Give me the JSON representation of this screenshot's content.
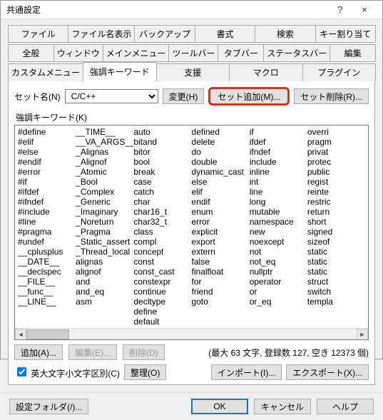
{
  "window": {
    "title": "共通設定",
    "help": "?",
    "close": "×"
  },
  "tabs": {
    "row1": [
      "ファイル",
      "ファイル名表示",
      "バックアップ",
      "書式",
      "検索",
      "キー割り当て"
    ],
    "row2": [
      "全般",
      "ウィンドウ",
      "メインメニュー",
      "ツールバー",
      "タブバー",
      "ステータスバー",
      "編集"
    ],
    "row3": [
      "カスタムメニュー",
      "強調キーワード",
      "支援",
      "マクロ",
      "プラグイン"
    ],
    "active": "強調キーワード"
  },
  "setrow": {
    "label": "セット名(N)",
    "selected": "C/C++",
    "change": "変更(H)",
    "add": "セット追加(M)...",
    "delete": "セット削除(R)..."
  },
  "listLabel": "強調キーワード(K)",
  "cols": [
    [
      "#define",
      "#elif",
      "#else",
      "#endif",
      "#error",
      "#if",
      "#ifdef",
      "#ifndef",
      "#include",
      "#line",
      "#pragma",
      "#undef",
      "__cplusplus",
      "__DATE__",
      "__declspec",
      "__FILE__",
      "__func__",
      "__LINE__"
    ],
    [
      "__TIME__",
      "__VA_ARGS__",
      "_Alignas",
      "_Alignof",
      "_Atomic",
      "_Bool",
      "_Complex",
      "_Generic",
      "_Imaginary",
      "_Noreturn",
      "_Pragma",
      "_Static_assert",
      "_Thread_local",
      "alignas",
      "alignof",
      "and",
      "and_eq",
      "asm"
    ],
    [
      "auto",
      "bitand",
      "bitor",
      "bool",
      "break",
      "case",
      "catch",
      "char",
      "char16_t",
      "char32_t",
      "class",
      "compl",
      "concept",
      "const",
      "const_cast",
      "constexpr",
      "continue",
      "decltype",
      "define",
      "default"
    ],
    [
      "defined",
      "delete",
      "do",
      "double",
      "dynamic_cast",
      "else",
      "elif",
      "endif",
      "enum",
      "error",
      "explicit",
      "export",
      "extern",
      "false",
      "finalfloat",
      "for",
      "friend",
      "goto"
    ],
    [
      "if",
      "ifdef",
      "ifndef",
      "include",
      "inline",
      "int",
      "line",
      "long",
      "mutable",
      "namespace",
      "new",
      "noexcept",
      "not",
      "not_eq",
      "nullptr",
      "operator",
      "or",
      "or_eq"
    ],
    [
      "overri",
      "pragm",
      "privat",
      "protec",
      "public",
      "regist",
      "reinte",
      "restric",
      "return",
      "short",
      "signed",
      "sizeof",
      "static",
      "static",
      "static",
      "struct",
      "switch",
      "templa"
    ]
  ],
  "buttons": {
    "add": "追加(A)...",
    "edit": "編集(E)...",
    "del": "削除(D)",
    "stats": "(最大 63 文字, 登録数 127, 空き 12373 個)",
    "caseChk": "英大文字小文字区別(C)",
    "sort": "整理(O)",
    "import": "インポート(I)...",
    "export": "エクスポート(X)..."
  },
  "bottom": {
    "folder": "設定フォルダ(/)...",
    "ok": "OK",
    "cancel": "キャンセル",
    "help": "ヘルプ"
  }
}
